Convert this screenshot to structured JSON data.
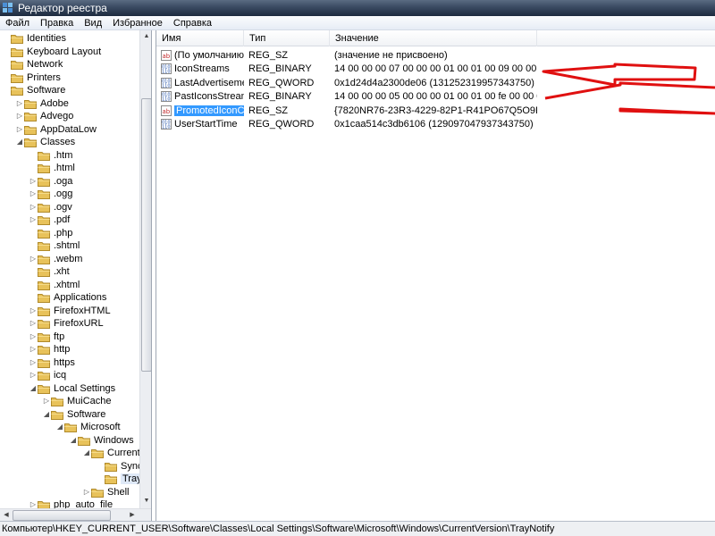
{
  "window": {
    "title": "Редактор реестра"
  },
  "menu": [
    "Файл",
    "Правка",
    "Вид",
    "Избранное",
    "Справка"
  ],
  "tree": [
    {
      "label": "Identities",
      "level": 0,
      "expander": "none"
    },
    {
      "label": "Keyboard Layout",
      "level": 0,
      "expander": "none"
    },
    {
      "label": "Network",
      "level": 0,
      "expander": "none"
    },
    {
      "label": "Printers",
      "level": 0,
      "expander": "none"
    },
    {
      "label": "Software",
      "level": 0,
      "expander": "none"
    },
    {
      "label": "Adobe",
      "level": 1,
      "expander": "collapsed"
    },
    {
      "label": "Advego",
      "level": 1,
      "expander": "collapsed"
    },
    {
      "label": "AppDataLow",
      "level": 1,
      "expander": "collapsed"
    },
    {
      "label": "Classes",
      "level": 1,
      "expander": "expanded"
    },
    {
      "label": ".htm",
      "level": 2,
      "expander": "none"
    },
    {
      "label": ".html",
      "level": 2,
      "expander": "none"
    },
    {
      "label": ".oga",
      "level": 2,
      "expander": "collapsed"
    },
    {
      "label": ".ogg",
      "level": 2,
      "expander": "collapsed"
    },
    {
      "label": ".ogv",
      "level": 2,
      "expander": "collapsed"
    },
    {
      "label": ".pdf",
      "level": 2,
      "expander": "collapsed"
    },
    {
      "label": ".php",
      "level": 2,
      "expander": "none"
    },
    {
      "label": ".shtml",
      "level": 2,
      "expander": "none"
    },
    {
      "label": ".webm",
      "level": 2,
      "expander": "collapsed"
    },
    {
      "label": ".xht",
      "level": 2,
      "expander": "none"
    },
    {
      "label": ".xhtml",
      "level": 2,
      "expander": "none"
    },
    {
      "label": "Applications",
      "level": 2,
      "expander": "none"
    },
    {
      "label": "FirefoxHTML",
      "level": 2,
      "expander": "collapsed"
    },
    {
      "label": "FirefoxURL",
      "level": 2,
      "expander": "collapsed"
    },
    {
      "label": "ftp",
      "level": 2,
      "expander": "collapsed"
    },
    {
      "label": "http",
      "level": 2,
      "expander": "collapsed"
    },
    {
      "label": "https",
      "level": 2,
      "expander": "collapsed"
    },
    {
      "label": "icq",
      "level": 2,
      "expander": "collapsed"
    },
    {
      "label": "Local Settings",
      "level": 2,
      "expander": "expanded"
    },
    {
      "label": "MuiCache",
      "level": 3,
      "expander": "collapsed"
    },
    {
      "label": "Software",
      "level": 3,
      "expander": "expanded"
    },
    {
      "label": "Microsoft",
      "level": 4,
      "expander": "expanded"
    },
    {
      "label": "Windows",
      "level": 5,
      "expander": "expanded"
    },
    {
      "label": "CurrentVer",
      "level": 6,
      "expander": "expanded"
    },
    {
      "label": "SyncMo",
      "level": 7,
      "expander": "none"
    },
    {
      "label": "TrayNo",
      "level": 7,
      "expander": "none",
      "selected": true
    },
    {
      "label": "Shell",
      "level": 6,
      "expander": "collapsed"
    },
    {
      "label": "php_auto_file",
      "level": 2,
      "expander": "collapsed"
    }
  ],
  "columns": [
    "Имя",
    "Тип",
    "Значение"
  ],
  "values": [
    {
      "icon": "string-value-icon",
      "name": "(По умолчанию)",
      "type": "REG_SZ",
      "data": "(значение не присвоено)"
    },
    {
      "icon": "binary-value-icon",
      "name": "IconStreams",
      "type": "REG_BINARY",
      "data": "14 00 00 00 07 00 00 00 01 00 01 00 09 00 00 00 14 00..."
    },
    {
      "icon": "binary-value-icon",
      "name": "LastAdvertiseme...",
      "type": "REG_QWORD",
      "data": "0x1d24d4a2300de06 (131252319957343750)"
    },
    {
      "icon": "binary-value-icon",
      "name": "PastIconsStream",
      "type": "REG_BINARY",
      "data": "14 00 00 00 05 00 00 00 01 00 01 00 fe 00 00 00 14 00..."
    },
    {
      "icon": "string-value-icon",
      "name": "PromotedIconC...",
      "type": "REG_SZ",
      "data": "{7820NR76-23R3-4229-82P1-R41PO67Q5O9P},{782...",
      "selected": true
    },
    {
      "icon": "binary-value-icon",
      "name": "UserStartTime",
      "type": "REG_QWORD",
      "data": "0x1caa514c3db6106 (129097047937343750)"
    }
  ],
  "status": {
    "path": "Компьютер\\HKEY_CURRENT_USER\\Software\\Classes\\Local Settings\\Software\\Microsoft\\Windows\\CurrentVersion\\TrayNotify"
  },
  "colors": {
    "annotation_arrow": "#e01010",
    "selection": "#3399ff",
    "folder": "#e8c25a"
  }
}
